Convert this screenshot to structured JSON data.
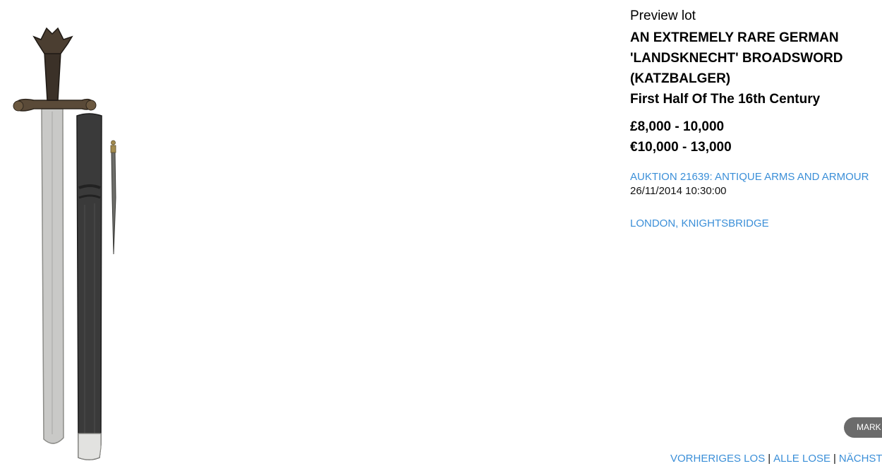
{
  "lot": {
    "preview_label": "Preview lot",
    "title_lines": [
      "AN EXTREMELY RARE GERMAN",
      "'LANDSKNECHT' BROADSWORD",
      "(KATZBALGER)"
    ],
    "subtitle": "First Half Of The 16th Century",
    "estimates": [
      "£8,000 - 10,000",
      "€10,000 - 13,000"
    ]
  },
  "sale": {
    "name": "AUKTION 21639: ANTIQUE ARMS AND ARMOUR",
    "date": "26/11/2014 10:30:00",
    "location": "LONDON, KNIGHTSBRIDGE"
  },
  "actions": {
    "mark_label": "MARK"
  },
  "navigation": {
    "previous": "VORHERIGES LOS",
    "all": "ALLE LOSE",
    "next": "NÄCHST",
    "separator": "|"
  },
  "colors": {
    "link": "#3b8fd8",
    "mark_button_bg": "#6b6b6b"
  }
}
